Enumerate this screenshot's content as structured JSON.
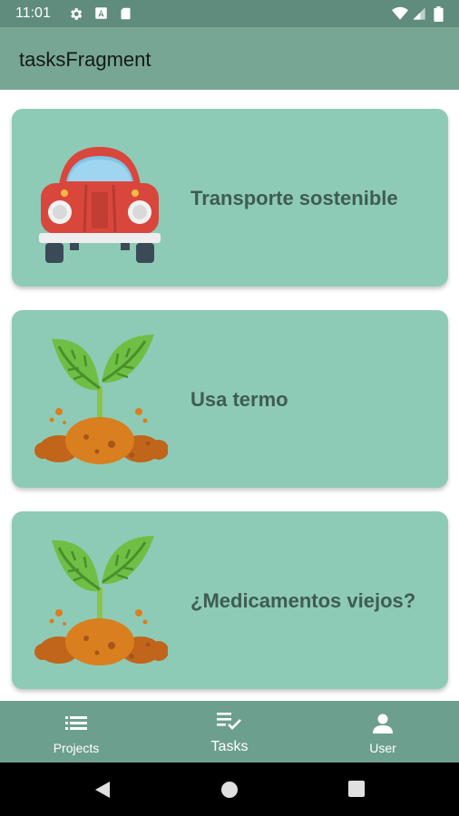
{
  "status_bar": {
    "time": "11:01",
    "icons": [
      "settings-icon",
      "a-icon",
      "sd-card-icon",
      "wifi-icon",
      "signal-icon",
      "battery-icon"
    ]
  },
  "app_bar": {
    "title": "tasksFragment"
  },
  "tasks": [
    {
      "title": "Transporte sostenible",
      "icon": "car-icon"
    },
    {
      "title": "Usa termo",
      "icon": "sprout-icon"
    },
    {
      "title": "¿Medicamentos viejos?",
      "icon": "sprout-icon"
    }
  ],
  "bottom_nav": {
    "items": [
      {
        "label": "Projects",
        "icon": "list-icon",
        "active": false
      },
      {
        "label": "Tasks",
        "icon": "task-check-icon",
        "active": true
      },
      {
        "label": "User",
        "icon": "user-icon",
        "active": false
      }
    ]
  },
  "colors": {
    "status_bar": "#5f8c7c",
    "app_bar": "#78a695",
    "card": "#8ecbb7",
    "card_text": "#3f5c52",
    "bottom_nav": "#6d9f8e"
  }
}
